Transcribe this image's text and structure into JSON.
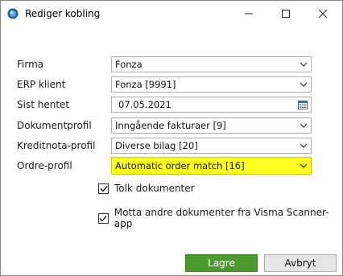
{
  "window": {
    "title": "Rediger kobling",
    "controls": [
      "minimize-icon",
      "maximize-icon",
      "close-icon"
    ]
  },
  "form": {
    "fields": [
      {
        "label": "Firma",
        "value": "Fonza",
        "type": "dropdown"
      },
      {
        "label": "ERP klient",
        "value": "Fonza [9991]",
        "type": "dropdown"
      },
      {
        "label": "Sist hentet",
        "value": "07.05.2021",
        "type": "date"
      },
      {
        "label": "Dokumentprofil",
        "value": "Inngående fakturaer [9]",
        "type": "dropdown"
      },
      {
        "label": "Kreditnota-profil",
        "value": "Diverse bilag [20]",
        "type": "dropdown"
      },
      {
        "label": "Ordre-profil",
        "value": "Automatic order match [16]",
        "type": "dropdown",
        "highlight": "#ffff22"
      }
    ],
    "checkboxes": [
      {
        "label": "Tolk dokumenter",
        "checked": true
      },
      {
        "label": "Motta andre dokumenter fra Visma Scanner-app",
        "checked": true
      }
    ]
  },
  "buttons": {
    "save": "Lagre",
    "cancel": "Avbryt"
  },
  "colors": {
    "primary_button": "#4b9a2e",
    "highlight": "#ffff22",
    "border": "#acacac"
  }
}
